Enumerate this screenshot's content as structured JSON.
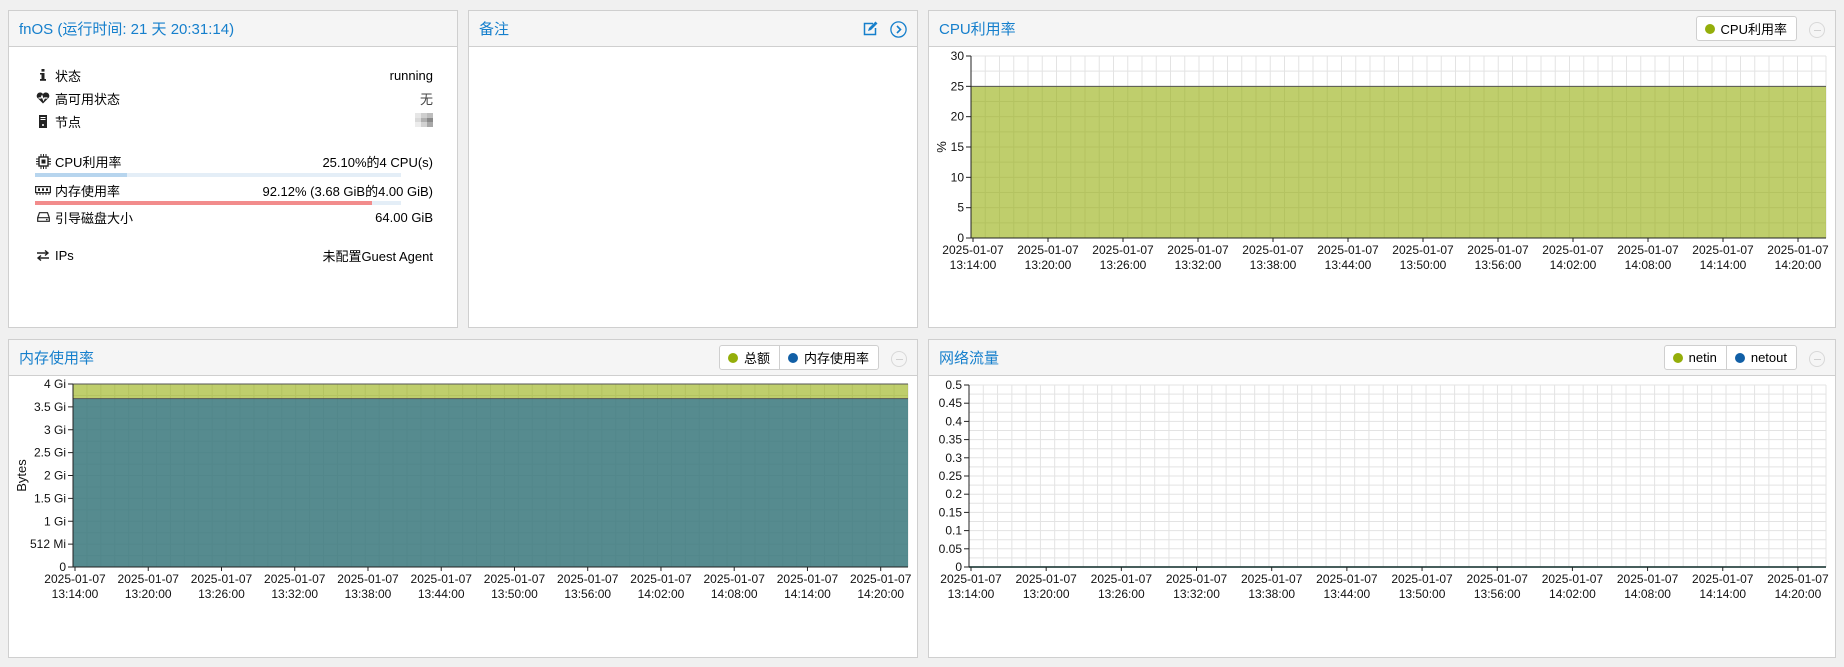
{
  "status_panel": {
    "title": "fnOS (运行时间: 21 天 20:31:14)",
    "rows": {
      "state": {
        "label": "状态",
        "value": "running"
      },
      "ha": {
        "label": "高可用状态",
        "value": "无"
      },
      "node": {
        "label": "节点"
      },
      "cpu": {
        "label": "CPU利用率",
        "value": "25.10%的4 CPU(s)",
        "fraction": 0.251
      },
      "mem": {
        "label": "内存使用率",
        "value": "92.12% (3.68 GiB的4.00 GiB)",
        "fraction": 0.9212
      },
      "disk": {
        "label": "引导磁盘大小",
        "value": "64.00 GiB"
      },
      "ips": {
        "label": "IPs",
        "value": "未配置Guest Agent"
      }
    },
    "colors": {
      "cpu_bar": "#b7d5ee",
      "mem_bar": "#f28c8c",
      "bar_track": "#e4eef7"
    }
  },
  "notes_panel": {
    "title": "备注",
    "icons": [
      "edit-icon",
      "chevron-right-circle-icon"
    ]
  },
  "cpu_panel": {
    "title": "CPU利用率"
  },
  "mem_panel": {
    "title": "内存使用率"
  },
  "net_panel": {
    "title": "网络流量"
  },
  "x_ticks": [
    [
      "2025-01-07",
      "13:14:00"
    ],
    [
      "2025-01-07",
      "13:20:00"
    ],
    [
      "2025-01-07",
      "13:26:00"
    ],
    [
      "2025-01-07",
      "13:32:00"
    ],
    [
      "2025-01-07",
      "13:38:00"
    ],
    [
      "2025-01-07",
      "13:44:00"
    ],
    [
      "2025-01-07",
      "13:50:00"
    ],
    [
      "2025-01-07",
      "13:56:00"
    ],
    [
      "2025-01-07",
      "14:02:00"
    ],
    [
      "2025-01-07",
      "14:08:00"
    ],
    [
      "2025-01-07",
      "14:14:00"
    ],
    [
      "2025-01-07",
      "14:20:00"
    ]
  ],
  "chart_data": [
    {
      "type": "area",
      "title": "CPU利用率",
      "ylabel": "%",
      "ylim": [
        0,
        30
      ],
      "yticks": [
        "0",
        "5",
        "10",
        "15",
        "20",
        "25",
        "30"
      ],
      "series": [
        {
          "name": "CPU利用率",
          "color": "#94ae0a",
          "value": 25
        }
      ],
      "grid": true,
      "legend": "top-right"
    },
    {
      "type": "area",
      "title": "内存使用率",
      "ylabel": "Bytes",
      "ylim": [
        0,
        4294967296
      ],
      "yticks": [
        "0",
        "512 Mi",
        "1 Gi",
        "1.5 Gi",
        "2 Gi",
        "2.5 Gi",
        "3 Gi",
        "3.5 Gi",
        "4 Gi"
      ],
      "series": [
        {
          "name": "总额",
          "color": "#94ae0a",
          "value": 4294967296
        },
        {
          "name": "内存使用率",
          "color": "#115fa6",
          "value": 3951369912
        }
      ],
      "grid": true,
      "legend": "top-right"
    },
    {
      "type": "line",
      "title": "网络流量",
      "ylabel": "",
      "ylim": [
        0,
        0.5
      ],
      "yticks": [
        "0",
        "0.05",
        "0.1",
        "0.15",
        "0.2",
        "0.25",
        "0.3",
        "0.35",
        "0.4",
        "0.45",
        "0.5"
      ],
      "series": [
        {
          "name": "netin",
          "color": "#94ae0a",
          "value": 0
        },
        {
          "name": "netout",
          "color": "#115fa6",
          "value": 0
        }
      ],
      "grid": true,
      "legend": "top-right"
    }
  ]
}
